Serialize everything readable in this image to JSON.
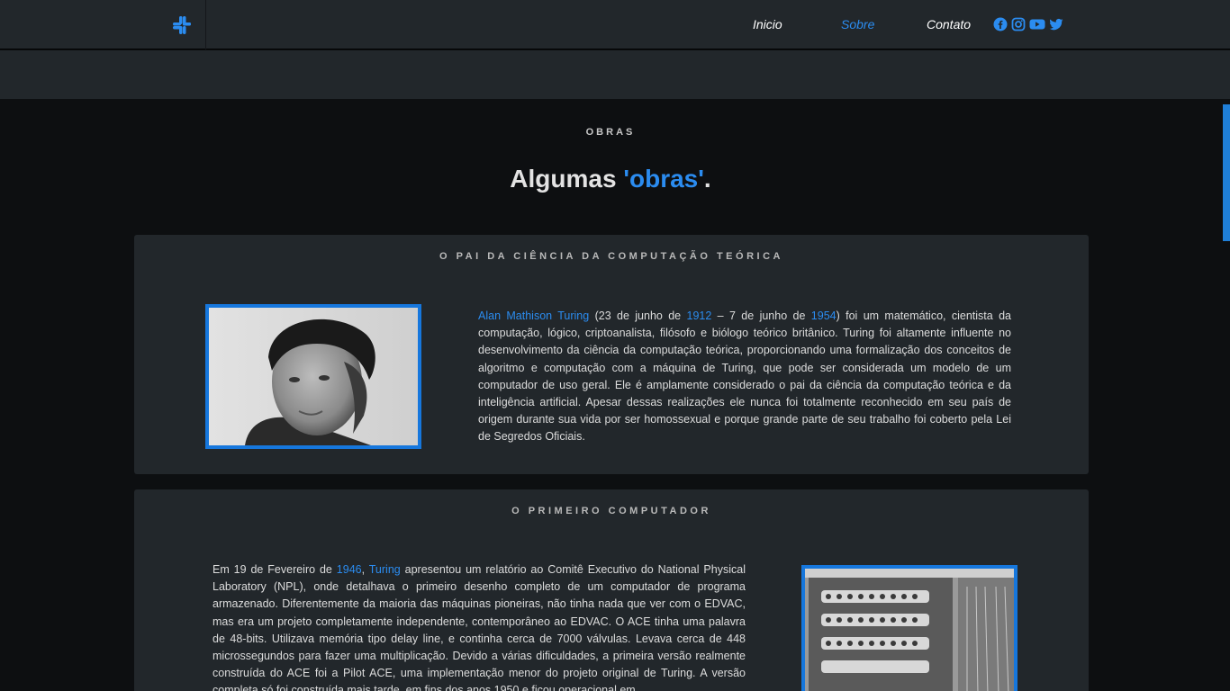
{
  "nav": {
    "items": [
      "Inicio",
      "Sobre",
      "Contato"
    ],
    "social_icons": [
      "facebook-icon",
      "instagram-icon",
      "youtube-icon",
      "twitter-icon"
    ],
    "logo_icon": "slack-like-logo-icon"
  },
  "section": {
    "eyebrow": "OBRAS",
    "heading_pre": "Algumas ",
    "heading_hl": "'obras'",
    "heading_post": "."
  },
  "card1": {
    "title": "O PAI DA CIÊNCIA DA COMPUTAÇÃO TEÓRICA",
    "image_alt": "Retrato de Alan Turing",
    "link_name": "Alan Mathison Turing",
    "t1": " (23 de junho de ",
    "link_1912": "1912",
    "t2": " – 7 de junho de ",
    "link_1954": "1954",
    "t3": ") foi um matemático, cientista da computação, lógico, criptoanalista, filósofo e biólogo teórico britânico. Turing foi altamente influente no desenvolvimento da ciência da computação teórica, proporcionando uma formalização dos conceitos de algoritmo e computação com a máquina de Turing, que pode ser considerada um modelo de um computador de uso geral. Ele é amplamente considerado o pai da ciência da computação teórica e da inteligência artificial. Apesar dessas realizações ele nunca foi totalmente reconhecido em seu país de origem durante sua vida por ser homossexual e porque grande parte de seu trabalho foi coberto pela Lei de Segredos Oficiais."
  },
  "card2": {
    "title": "O PRIMEIRO COMPUTADOR",
    "image_alt": "Máquina Pilot ACE",
    "t1": "Em 19 de Fevereiro de ",
    "link_1946": "1946",
    "t2": ", ",
    "link_turing": "Turing",
    "t3": " apresentou um relatório ao Comitê Executivo do National Physical Laboratory (NPL), onde detalhava o primeiro desenho completo de um computador de programa armazenado. Diferentemente da maioria das máquinas pioneiras, não tinha nada que ver com o EDVAC, mas era um projeto completamente independente, contemporâneo ao EDVAC. O ACE tinha uma palavra de 48-bits. Utilizava memória tipo delay line, e continha cerca de 7000 válvulas. Levava cerca de 448 microssegundos para fazer uma multiplicação. Devido a várias dificuldades, a primeira versão realmente construída do ACE foi a Pilot ACE, uma implementação menor do projeto original de Turing. A versão completa só foi construída mais tarde, em fins dos anos 1950 e ficou operacional em"
  },
  "colors": {
    "accent": "#2b8cf0",
    "card_bg": "#22272b",
    "page_bg": "#0d0f11"
  }
}
